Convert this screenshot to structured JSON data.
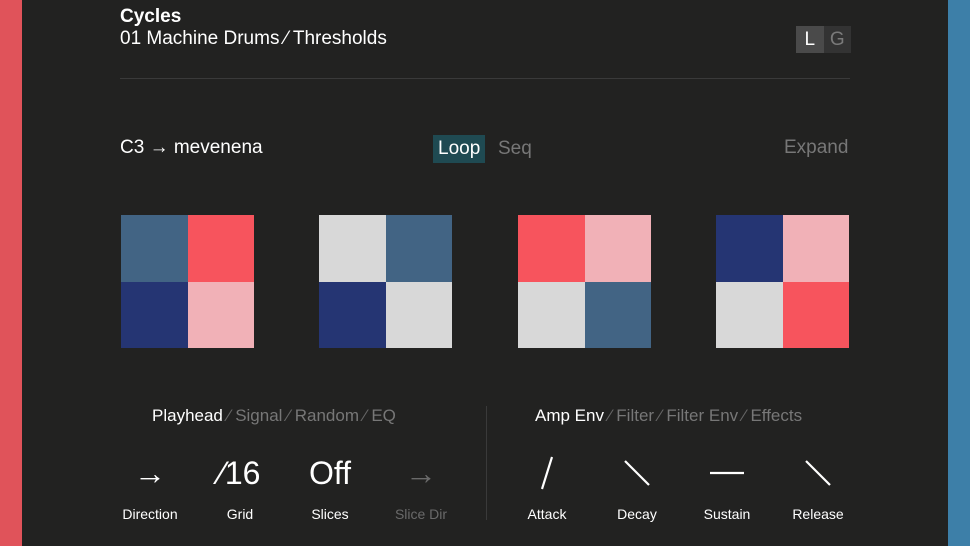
{
  "header": {
    "title": "Cycles",
    "subtitle": "01 Machine Drums ⁄ Thresholds",
    "toggle": {
      "left": "L",
      "right": "G"
    }
  },
  "toolbar": {
    "mapping": "C3 → mevenena",
    "mode_loop": "Loop",
    "mode_seq": "Seq",
    "expand": "Expand"
  },
  "colors": {
    "red": "#f7545d",
    "pink": "#f1b1b7",
    "navy": "#253573",
    "slate": "#426484",
    "light": "#d8d8d8"
  },
  "pads": [
    [
      "slate",
      "red",
      "navy",
      "pink"
    ],
    [
      "light",
      "slate",
      "navy",
      "light"
    ],
    [
      "red",
      "pink",
      "light",
      "slate"
    ],
    [
      "navy",
      "pink",
      "light",
      "red"
    ]
  ],
  "left_panel": {
    "tabs": [
      "Playhead",
      "Signal",
      "Random",
      "EQ"
    ],
    "controls": [
      {
        "value": "→",
        "label": "Direction"
      },
      {
        "value": "⁄16",
        "label": "Grid"
      },
      {
        "value": "Off",
        "label": "Slices"
      },
      {
        "value": "→",
        "label": "Slice Dir"
      }
    ]
  },
  "right_panel": {
    "tabs": [
      "Amp Env",
      "Filter",
      "Filter Env",
      "Effects"
    ],
    "controls": [
      {
        "icon": "attack-curve-icon",
        "label": "Attack"
      },
      {
        "icon": "decay-curve-icon",
        "label": "Decay"
      },
      {
        "icon": "sustain-level-icon",
        "label": "Sustain"
      },
      {
        "icon": "release-curve-icon",
        "label": "Release"
      }
    ]
  }
}
